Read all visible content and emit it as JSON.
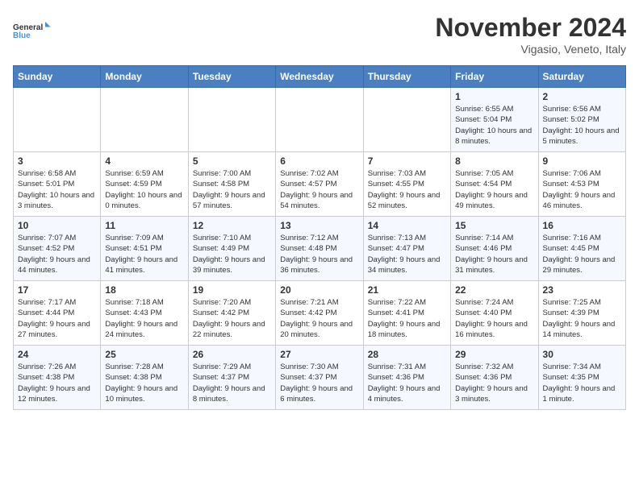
{
  "header": {
    "logo_line1": "General",
    "logo_line2": "Blue",
    "month_title": "November 2024",
    "subtitle": "Vigasio, Veneto, Italy"
  },
  "days_of_week": [
    "Sunday",
    "Monday",
    "Tuesday",
    "Wednesday",
    "Thursday",
    "Friday",
    "Saturday"
  ],
  "weeks": [
    [
      {
        "day": "",
        "info": ""
      },
      {
        "day": "",
        "info": ""
      },
      {
        "day": "",
        "info": ""
      },
      {
        "day": "",
        "info": ""
      },
      {
        "day": "",
        "info": ""
      },
      {
        "day": "1",
        "info": "Sunrise: 6:55 AM\nSunset: 5:04 PM\nDaylight: 10 hours and 8 minutes."
      },
      {
        "day": "2",
        "info": "Sunrise: 6:56 AM\nSunset: 5:02 PM\nDaylight: 10 hours and 5 minutes."
      }
    ],
    [
      {
        "day": "3",
        "info": "Sunrise: 6:58 AM\nSunset: 5:01 PM\nDaylight: 10 hours and 3 minutes."
      },
      {
        "day": "4",
        "info": "Sunrise: 6:59 AM\nSunset: 4:59 PM\nDaylight: 10 hours and 0 minutes."
      },
      {
        "day": "5",
        "info": "Sunrise: 7:00 AM\nSunset: 4:58 PM\nDaylight: 9 hours and 57 minutes."
      },
      {
        "day": "6",
        "info": "Sunrise: 7:02 AM\nSunset: 4:57 PM\nDaylight: 9 hours and 54 minutes."
      },
      {
        "day": "7",
        "info": "Sunrise: 7:03 AM\nSunset: 4:55 PM\nDaylight: 9 hours and 52 minutes."
      },
      {
        "day": "8",
        "info": "Sunrise: 7:05 AM\nSunset: 4:54 PM\nDaylight: 9 hours and 49 minutes."
      },
      {
        "day": "9",
        "info": "Sunrise: 7:06 AM\nSunset: 4:53 PM\nDaylight: 9 hours and 46 minutes."
      }
    ],
    [
      {
        "day": "10",
        "info": "Sunrise: 7:07 AM\nSunset: 4:52 PM\nDaylight: 9 hours and 44 minutes."
      },
      {
        "day": "11",
        "info": "Sunrise: 7:09 AM\nSunset: 4:51 PM\nDaylight: 9 hours and 41 minutes."
      },
      {
        "day": "12",
        "info": "Sunrise: 7:10 AM\nSunset: 4:49 PM\nDaylight: 9 hours and 39 minutes."
      },
      {
        "day": "13",
        "info": "Sunrise: 7:12 AM\nSunset: 4:48 PM\nDaylight: 9 hours and 36 minutes."
      },
      {
        "day": "14",
        "info": "Sunrise: 7:13 AM\nSunset: 4:47 PM\nDaylight: 9 hours and 34 minutes."
      },
      {
        "day": "15",
        "info": "Sunrise: 7:14 AM\nSunset: 4:46 PM\nDaylight: 9 hours and 31 minutes."
      },
      {
        "day": "16",
        "info": "Sunrise: 7:16 AM\nSunset: 4:45 PM\nDaylight: 9 hours and 29 minutes."
      }
    ],
    [
      {
        "day": "17",
        "info": "Sunrise: 7:17 AM\nSunset: 4:44 PM\nDaylight: 9 hours and 27 minutes."
      },
      {
        "day": "18",
        "info": "Sunrise: 7:18 AM\nSunset: 4:43 PM\nDaylight: 9 hours and 24 minutes."
      },
      {
        "day": "19",
        "info": "Sunrise: 7:20 AM\nSunset: 4:42 PM\nDaylight: 9 hours and 22 minutes."
      },
      {
        "day": "20",
        "info": "Sunrise: 7:21 AM\nSunset: 4:42 PM\nDaylight: 9 hours and 20 minutes."
      },
      {
        "day": "21",
        "info": "Sunrise: 7:22 AM\nSunset: 4:41 PM\nDaylight: 9 hours and 18 minutes."
      },
      {
        "day": "22",
        "info": "Sunrise: 7:24 AM\nSunset: 4:40 PM\nDaylight: 9 hours and 16 minutes."
      },
      {
        "day": "23",
        "info": "Sunrise: 7:25 AM\nSunset: 4:39 PM\nDaylight: 9 hours and 14 minutes."
      }
    ],
    [
      {
        "day": "24",
        "info": "Sunrise: 7:26 AM\nSunset: 4:38 PM\nDaylight: 9 hours and 12 minutes."
      },
      {
        "day": "25",
        "info": "Sunrise: 7:28 AM\nSunset: 4:38 PM\nDaylight: 9 hours and 10 minutes."
      },
      {
        "day": "26",
        "info": "Sunrise: 7:29 AM\nSunset: 4:37 PM\nDaylight: 9 hours and 8 minutes."
      },
      {
        "day": "27",
        "info": "Sunrise: 7:30 AM\nSunset: 4:37 PM\nDaylight: 9 hours and 6 minutes."
      },
      {
        "day": "28",
        "info": "Sunrise: 7:31 AM\nSunset: 4:36 PM\nDaylight: 9 hours and 4 minutes."
      },
      {
        "day": "29",
        "info": "Sunrise: 7:32 AM\nSunset: 4:36 PM\nDaylight: 9 hours and 3 minutes."
      },
      {
        "day": "30",
        "info": "Sunrise: 7:34 AM\nSunset: 4:35 PM\nDaylight: 9 hours and 1 minute."
      }
    ]
  ]
}
